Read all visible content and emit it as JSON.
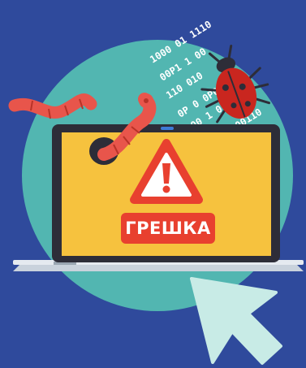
{
  "error_label": "ГРЕШКА",
  "binary_lines": [
    "1000 01 1110",
    "00P1 1 00",
    "110 010",
    "0P 0 0P00",
    "100 1 011",
    "001010 00110"
  ],
  "colors": {
    "background": "#2f4a9c",
    "circle": "#52b6b1",
    "screen": "#f6c23e",
    "warning": "#e8402f",
    "bug": "#c9261f",
    "worm": "#e8554b",
    "cursor": "#c8ebe6"
  },
  "icons": [
    "warning-triangle-icon",
    "bug-icon",
    "worm-icon",
    "cursor-icon"
  ]
}
